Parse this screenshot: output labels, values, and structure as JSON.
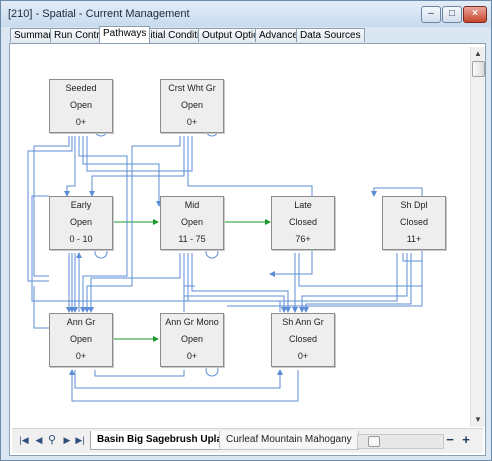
{
  "window": {
    "title": "[210] - Spatial - Current Management",
    "minimize": "–",
    "maximize": "□",
    "close": "×"
  },
  "tabs": [
    {
      "label": "Summary"
    },
    {
      "label": "Run Control"
    },
    {
      "label": "Pathways"
    },
    {
      "label": "Initial Conditions"
    },
    {
      "label": "Output Options"
    },
    {
      "label": "Advanced"
    },
    {
      "label": "Data Sources"
    }
  ],
  "active_tab": "Pathways",
  "states": [
    {
      "id": "seeded",
      "name": "Seeded",
      "cover": "Open",
      "age": "0+"
    },
    {
      "id": "crst-wht-gr",
      "name": "Crst Wht Gr",
      "cover": "Open",
      "age": "0+"
    },
    {
      "id": "early",
      "name": "Early",
      "cover": "Open",
      "age": "0 - 10"
    },
    {
      "id": "mid",
      "name": "Mid",
      "cover": "Open",
      "age": "11 - 75"
    },
    {
      "id": "late",
      "name": "Late",
      "cover": "Closed",
      "age": "76+"
    },
    {
      "id": "sh-dpl",
      "name": "Sh Dpl",
      "cover": "Closed",
      "age": "11+"
    },
    {
      "id": "ann-gr",
      "name": "Ann Gr",
      "cover": "Open",
      "age": "0+"
    },
    {
      "id": "ann-gr-mono",
      "name": "Ann Gr Mono",
      "cover": "Open",
      "age": "0+"
    },
    {
      "id": "sh-ann-gr",
      "name": "Sh Ann Gr",
      "cover": "Closed",
      "age": "0+"
    }
  ],
  "colors": {
    "deterministic_transition": "#1a9a2a",
    "probabilistic_transition": "#5b8ed6",
    "state_box": "#eeeeee"
  },
  "bottom": {
    "sheets": [
      {
        "label": "Basin Big Sagebrush Upland",
        "active": true
      },
      {
        "label": "Curleaf Mountain Mahogany",
        "active": false
      }
    ],
    "zoom_out": "−",
    "zoom_in": "+"
  }
}
